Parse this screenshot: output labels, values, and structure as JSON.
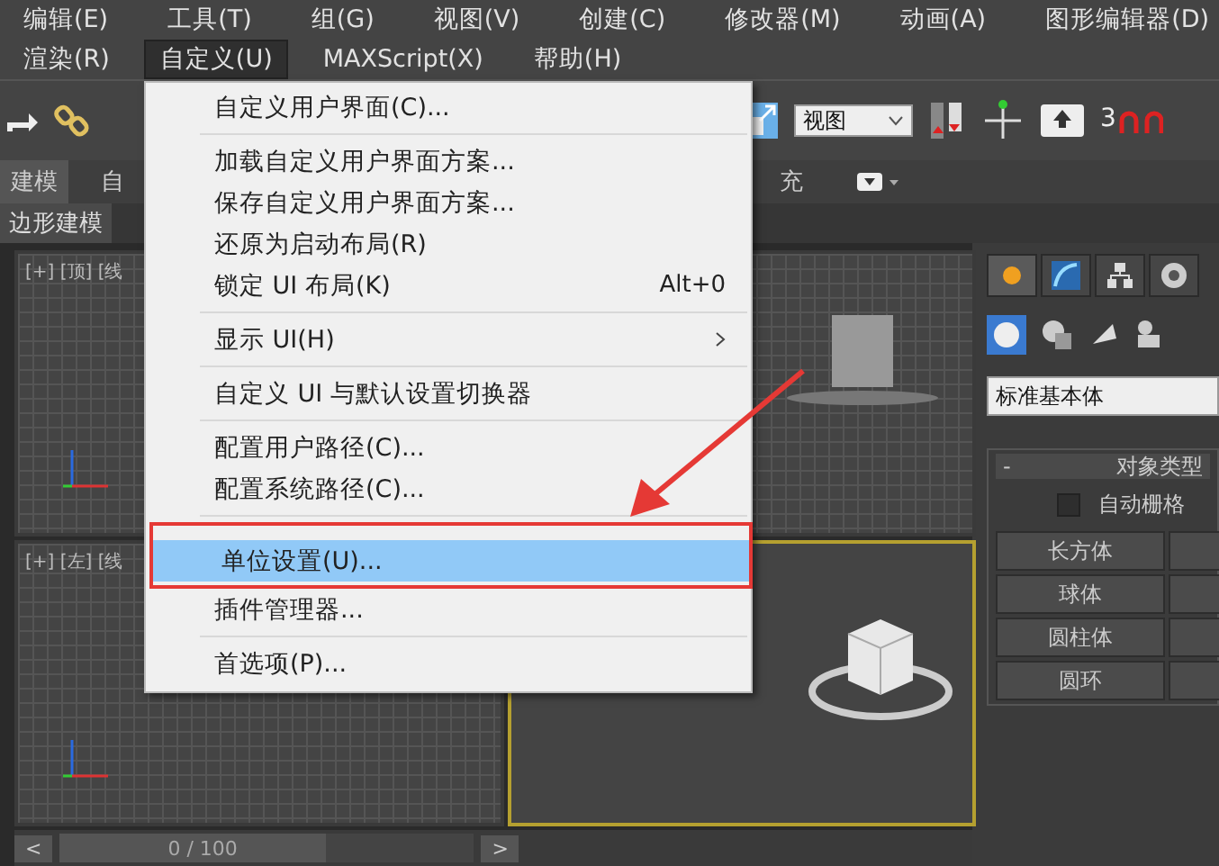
{
  "menu_bar": {
    "rows": [
      [
        {
          "label": "编辑(E)",
          "selected": false
        },
        {
          "label": "工具(T)",
          "selected": false
        },
        {
          "label": "组(G)",
          "selected": false
        },
        {
          "label": "视图(V)",
          "selected": false
        },
        {
          "label": "创建(C)",
          "selected": false
        },
        {
          "label": "修改器(M)",
          "selected": false
        },
        {
          "label": "动画(A)",
          "selected": false
        },
        {
          "label": "图形编辑器(D)",
          "selected": false
        }
      ],
      [
        {
          "label": "渲染(R)",
          "selected": false
        },
        {
          "label": "自定义(U)",
          "selected": true
        },
        {
          "label": "MAXScript(X)",
          "selected": false
        },
        {
          "label": "帮助(H)",
          "selected": false
        }
      ]
    ]
  },
  "toolbar": {
    "view_dropdown": "视图",
    "snap_label": "3"
  },
  "ribbon": {
    "tabs": [
      {
        "label": "建模",
        "selected": true
      },
      {
        "label": "自",
        "selected": false
      },
      {
        "label": "充",
        "selected": false
      }
    ],
    "subtab": "边形建模"
  },
  "viewports": [
    {
      "label": "[+] [顶] [线",
      "active": false
    },
    {
      "active": false
    },
    {
      "label": "[+] [左] [线",
      "active": false
    },
    {
      "active": true
    }
  ],
  "timeline": {
    "prev": "<",
    "position": "0 / 100",
    "level": 0,
    "next": ">"
  },
  "command_panel": {
    "tabs": [
      {
        "selected": true
      },
      {
        "selected": false
      },
      {
        "selected": false
      },
      {
        "selected": false
      }
    ],
    "category": "标准基本体",
    "rollout": {
      "collapse": "-",
      "title": "对象类型",
      "autogrid": {
        "label": "自动栅格",
        "checked": false
      },
      "buttons": [
        "长方体",
        "球体",
        "圆柱体",
        "圆环"
      ]
    }
  },
  "context_menu": {
    "items": [
      {
        "kind": "item",
        "label": "自定义用户界面(C)...",
        "selected": false
      },
      {
        "kind": "separator"
      },
      {
        "kind": "item",
        "label": "加载自定义用户界面方案...",
        "selected": false
      },
      {
        "kind": "item",
        "label": "保存自定义用户界面方案...",
        "selected": false
      },
      {
        "kind": "item",
        "label": "还原为启动布局(R)",
        "selected": false
      },
      {
        "kind": "item",
        "label": "锁定 UI 布局(K)",
        "shortcut": "Alt+0",
        "selected": false
      },
      {
        "kind": "separator"
      },
      {
        "kind": "item",
        "label": "显示 UI(H)",
        "submenu": true,
        "selected": false
      },
      {
        "kind": "separator"
      },
      {
        "kind": "item",
        "label": "自定义 UI 与默认设置切换器",
        "selected": false
      },
      {
        "kind": "separator"
      },
      {
        "kind": "item",
        "label": "配置用户路径(C)...",
        "selected": false
      },
      {
        "kind": "item",
        "label": "配置系统路径(C)...",
        "selected": false
      },
      {
        "kind": "separator"
      },
      {
        "kind": "item",
        "label": "单位设置(U)...",
        "selected": true
      },
      {
        "kind": "item",
        "label": "插件管理器...",
        "selected": false
      },
      {
        "kind": "separator"
      },
      {
        "kind": "item",
        "label": "首选项(P)...",
        "selected": false
      }
    ]
  }
}
